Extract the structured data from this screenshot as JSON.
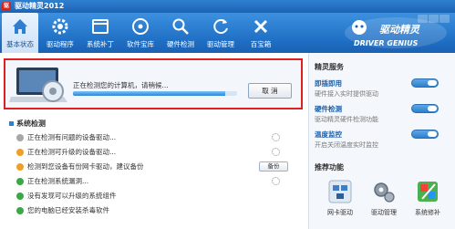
{
  "window": {
    "title": "驱动精灵2012"
  },
  "toolbar": {
    "items": [
      {
        "label": "基本状态",
        "icon": "home-icon",
        "active": true
      },
      {
        "label": "驱动程序",
        "icon": "gear-icon",
        "active": false
      },
      {
        "label": "系统补丁",
        "icon": "window-icon",
        "active": false
      },
      {
        "label": "软件宝库",
        "icon": "disc-icon",
        "active": false
      },
      {
        "label": "硬件检测",
        "icon": "search-icon",
        "active": false
      },
      {
        "label": "驱动管理",
        "icon": "refresh-icon",
        "active": false
      },
      {
        "label": "百宝箱",
        "icon": "tools-icon",
        "active": false
      }
    ],
    "brand": {
      "text": "驱动精灵",
      "subtext": "DRIVER GENIUS"
    }
  },
  "scan": {
    "status_text": "正在检测您的计算机，请稍候...",
    "progress": 0.93,
    "cancel_label": "取 消"
  },
  "system_check": {
    "title": "系统检测",
    "rows": [
      {
        "label": "正在检测有问题的设备驱动...",
        "status": "gray",
        "action": "spinner"
      },
      {
        "label": "正在检测可升级的设备驱动...",
        "status": "orange",
        "action": "spinner"
      },
      {
        "label": "检测到您设备有份网卡驱动，建议备份",
        "status": "orange",
        "action": "button",
        "action_label": "备份"
      },
      {
        "label": "正在检测系统漏洞...",
        "status": "green",
        "action": "spinner"
      },
      {
        "label": "没有发现可以升级的系统组件",
        "status": "green",
        "action": "none"
      },
      {
        "label": "您的电脑已经安装杀毒软件",
        "status": "green",
        "action": "none"
      }
    ]
  },
  "sidebar": {
    "services_title": "精灵服务",
    "services": [
      {
        "name": "即插即用",
        "desc": "硬件接入实时提供驱动"
      },
      {
        "name": "硬件检测",
        "desc": "驱动精灵硬件检测功能"
      },
      {
        "name": "温度监控",
        "desc": "开启关闭温度实时监控"
      }
    ],
    "recommend_title": "推荐功能",
    "recommend": [
      {
        "label": "网卡驱动",
        "icon": "network-icon"
      },
      {
        "label": "驱动管理",
        "icon": "gears-icon"
      },
      {
        "label": "系统修补",
        "icon": "palette-icon"
      }
    ]
  },
  "colors": {
    "accent": "#2f7fd0",
    "highlight_border": "#e02020"
  }
}
